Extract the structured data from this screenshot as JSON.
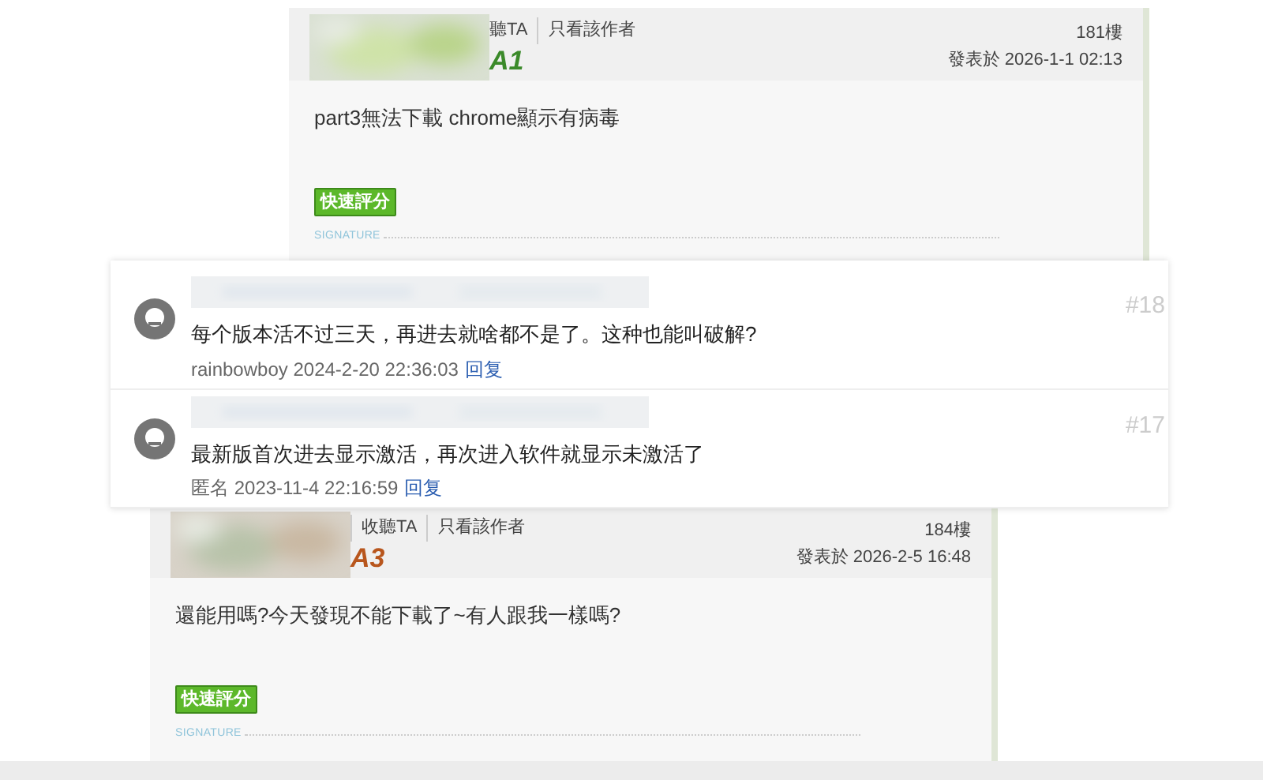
{
  "posts": [
    {
      "links": [
        "聽TA",
        "只看該作者"
      ],
      "floor": "181樓",
      "posted": "發表於 2026-1-1 02:13",
      "rank_badge": "A1",
      "body": "part3無法下載 chrome顯示有病毒",
      "rate_button": "快速評分",
      "signature": "SIGNATURE"
    },
    {
      "links": [
        "收聽TA",
        "只看該作者"
      ],
      "floor": "184樓",
      "posted": "發表於 2026-2-5 16:48",
      "rank_badge": "A3",
      "body": "還能用嗎?今天發現不能下載了~有人跟我一樣嗎?",
      "rate_button": "快速評分",
      "signature": "SIGNATURE"
    }
  ],
  "comments": [
    {
      "text": "每个版本活不过三天，再进去就啥都不是了。这种也能叫破解?",
      "author": "rainbowboy",
      "time": "2024-2-20 22:36:03",
      "reply": "回复",
      "number": "#18"
    },
    {
      "text": "最新版首次进去显示激活，再次进入软件就显示未激活了",
      "author": "匿名",
      "time": "2023-11-4 22:16:59",
      "reply": "回复",
      "number": "#17"
    }
  ]
}
